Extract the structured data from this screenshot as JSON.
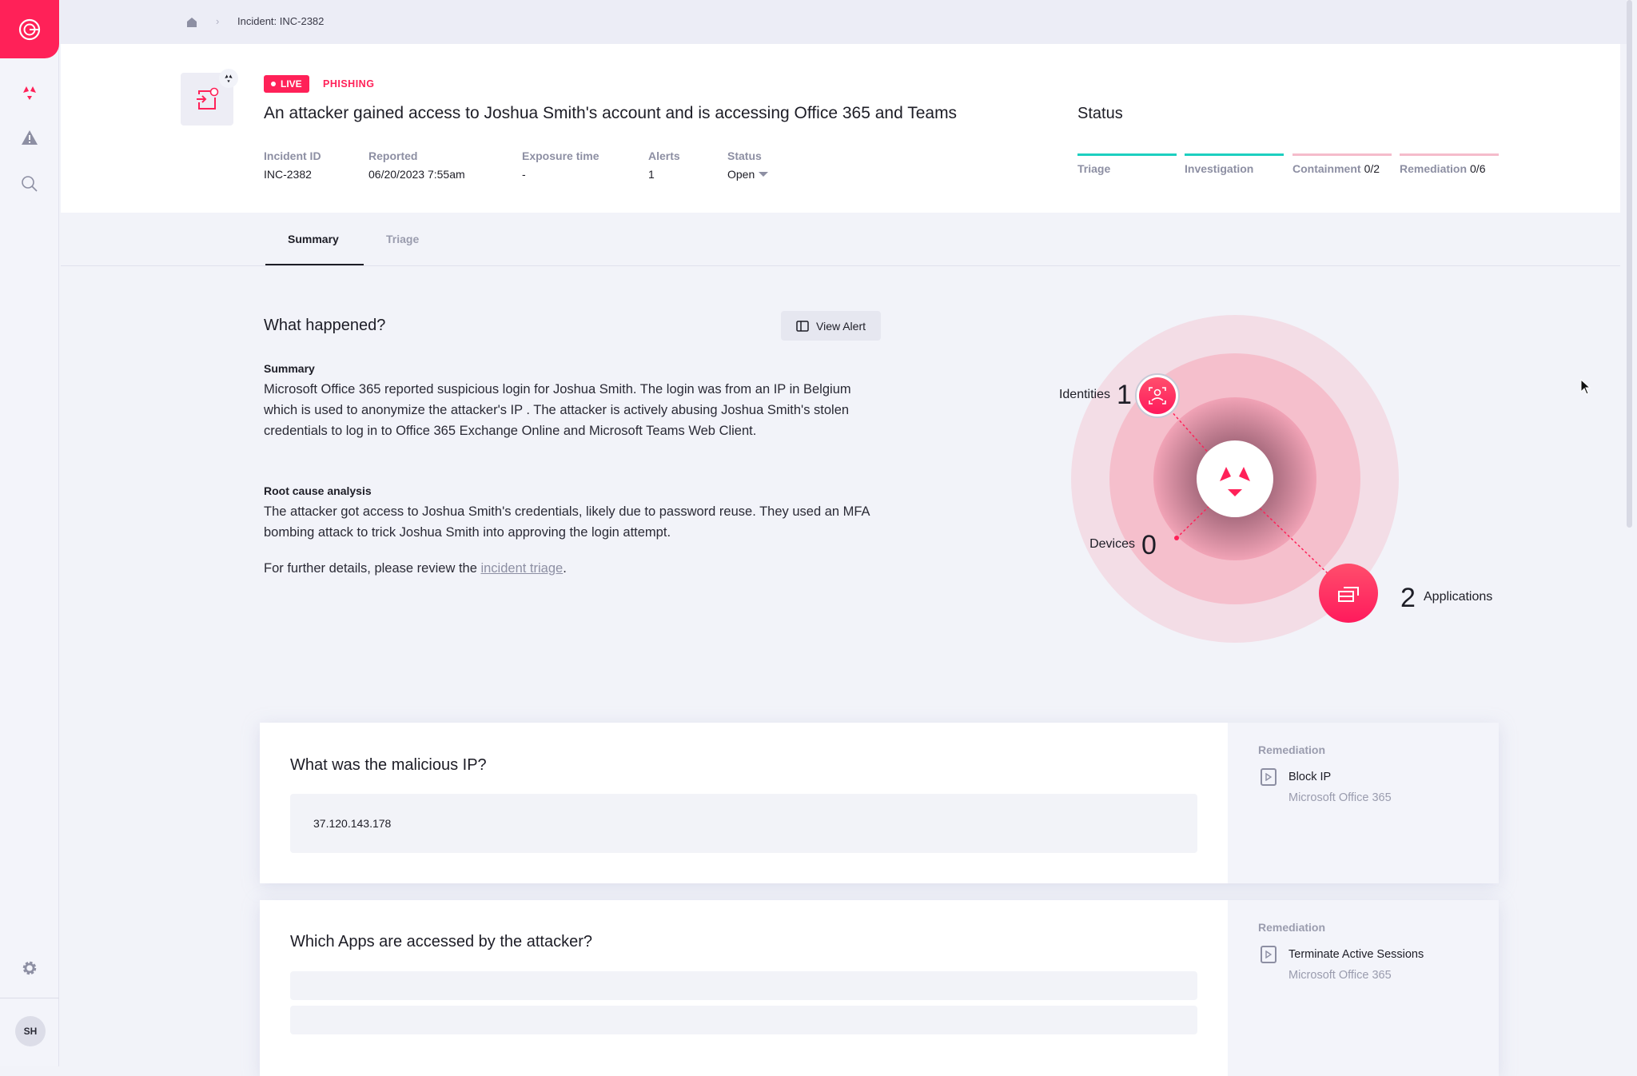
{
  "sidebar": {
    "logo": "gem-logo",
    "items": [
      {
        "icon": "incidents-icon"
      },
      {
        "icon": "alert-triangle-icon"
      },
      {
        "icon": "search-icon"
      }
    ],
    "settings_icon": "gear-icon",
    "avatar": "SH"
  },
  "breadcrumb": {
    "home_icon": "home-icon",
    "current": "Incident: INC-2382"
  },
  "incident": {
    "badge_live": "LIVE",
    "category": "PHISHING",
    "title": "An attacker gained access to Joshua Smith's account and is accessing Office 365 and Teams",
    "meta": [
      {
        "label": "Incident ID",
        "value": "INC-2382"
      },
      {
        "label": "Reported",
        "value": "06/20/2023 7:55am"
      },
      {
        "label": "Exposure time",
        "value": "-"
      },
      {
        "label": "Alerts",
        "value": "1"
      },
      {
        "label": "Status",
        "value": "Open"
      }
    ]
  },
  "status": {
    "title": "Status",
    "stages": [
      {
        "label": "Triage",
        "count": "",
        "color": "#1ccfc0"
      },
      {
        "label": "Investigation",
        "count": "",
        "color": "#1ccfc0"
      },
      {
        "label": "Containment",
        "count": "0/2",
        "color": "#f5bccb"
      },
      {
        "label": "Remediation",
        "count": "0/6",
        "color": "#f5bccb"
      }
    ]
  },
  "tabs": [
    {
      "label": "Summary",
      "active": true
    },
    {
      "label": "Triage",
      "active": false
    }
  ],
  "what_happened": {
    "title": "What happened?",
    "view_alert": "View Alert",
    "summary_label": "Summary",
    "summary": "Microsoft Office 365 reported suspicious login for Joshua Smith. The login was from an IP in Belgium which is used to anonymize the attacker's IP . The attacker is actively abusing Joshua Smith's stolen credentials to log in to Office 365 Exchange Online and Microsoft Teams Web Client.",
    "rca_label": "Root cause analysis",
    "rca": "The attacker got access to Joshua Smith's credentials, likely due to password reuse. They used an MFA bombing attack to trick Joshua Smith into approving the login attempt.",
    "further_prefix": "For further details, please review the ",
    "further_link": "incident triage",
    "further_suffix": "."
  },
  "graph": {
    "identities_label": "Identities",
    "identities": "1",
    "devices_label": "Devices",
    "devices": "0",
    "applications_label": "Applications",
    "applications": "2",
    "accent": "#ff2158"
  },
  "cards": [
    {
      "question": "What was the malicious IP?",
      "answers": [
        "37.120.143.178"
      ],
      "remediation_label": "Remediation",
      "action": "Block IP",
      "target": "Microsoft Office 365"
    },
    {
      "question": "Which Apps are accessed by the attacker?",
      "answers": [
        "",
        ""
      ],
      "remediation_label": "Remediation",
      "action": "Terminate Active Sessions",
      "target": "Microsoft Office 365"
    }
  ]
}
